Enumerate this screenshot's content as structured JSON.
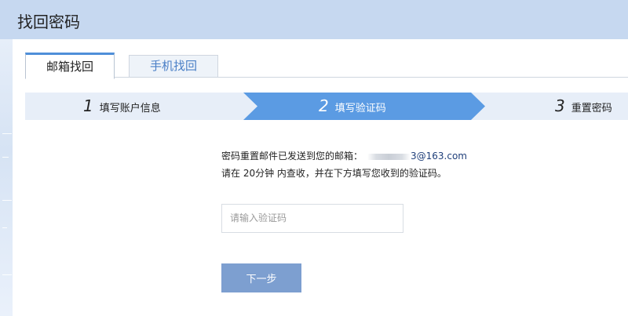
{
  "page": {
    "title": "找回密码"
  },
  "tabs": [
    {
      "label": "邮箱找回",
      "active": true
    },
    {
      "label": "手机找回",
      "active": false
    }
  ],
  "steps": [
    {
      "num": "1",
      "label": "填写账户信息",
      "active": false
    },
    {
      "num": "2",
      "label": "填写验证码",
      "active": true
    },
    {
      "num": "3",
      "label": "重置密码",
      "active": false
    }
  ],
  "message": {
    "line1_prefix": "密码重置邮件已发送到您的邮箱：",
    "email_suffix": "3@163.com",
    "line2": "请在 20分钟 内查收，并在下方填写您收到的验证码。"
  },
  "form": {
    "code_placeholder": "请输入验证码",
    "code_value": "",
    "next_label": "下一步"
  },
  "colors": {
    "header_bg": "#c6d8f0",
    "step_active": "#5b9be3",
    "step_inactive": "#e7eef8",
    "button_bg": "#7d9fd0",
    "tab_accent": "#4f8fd9"
  }
}
